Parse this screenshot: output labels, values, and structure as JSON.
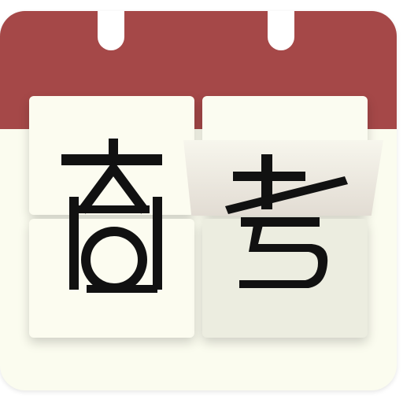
{
  "app_icon": {
    "characters": [
      "高",
      "考"
    ],
    "label": "高考"
  },
  "colors": {
    "header": "#a54848",
    "card": "#fcfcf0",
    "glyph": "#111111"
  },
  "icons": [
    "calendar-icon",
    "flip-card-icon"
  ]
}
